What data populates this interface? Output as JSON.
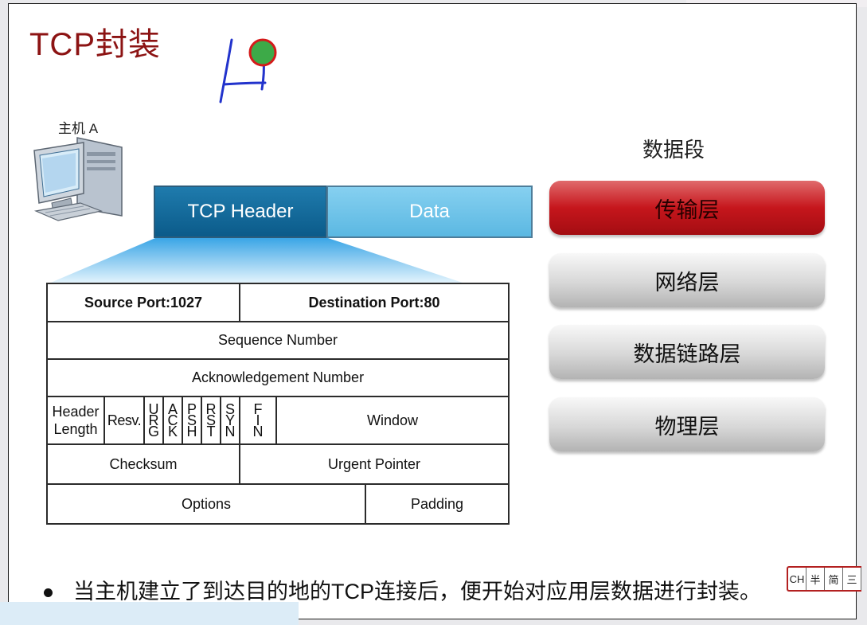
{
  "slide": {
    "title": "TCP封装",
    "host_label": "主机 A",
    "segment": {
      "header_label": "TCP Header",
      "data_label": "Data"
    },
    "tcp_header": {
      "source_port": "Source  Port:1027",
      "destination_port": "Destination  Port:80",
      "sequence_number": "Sequence Number",
      "ack_number": "Acknowledgement Number",
      "header_length": [
        "Header",
        "Length"
      ],
      "reserved": "Resv.",
      "flags": [
        [
          "U",
          "R",
          "G"
        ],
        [
          "A",
          "C",
          "K"
        ],
        [
          "P",
          "S",
          "H"
        ],
        [
          "R",
          "S",
          "T"
        ],
        [
          "S",
          "Y",
          "N"
        ],
        [
          "F",
          "I",
          "N"
        ]
      ],
      "window": "Window",
      "checksum": "Checksum",
      "urgent_pointer": "Urgent  Pointer",
      "options": "Options",
      "padding": "Padding"
    },
    "layers": {
      "caption": "数据段",
      "items": [
        {
          "label": "传输层",
          "active": true
        },
        {
          "label": "网络层",
          "active": false
        },
        {
          "label": "数据链路层",
          "active": false
        },
        {
          "label": "物理层",
          "active": false
        }
      ]
    },
    "bullet": "当主机建立了到达目的地的TCP连接后，便开始对应用层数据进行封装。"
  },
  "ime_toolbar": [
    "CH",
    "半",
    "简",
    "三"
  ],
  "colors": {
    "title": "#8c1313",
    "tcp_header_fill": "#0b5b8a",
    "data_fill": "#6cc1e8",
    "active_layer": "#c6161c",
    "port_text": "#b01622",
    "annotation_pen": "#2233cc",
    "annotation_dot": "#3daa48"
  },
  "icons": {
    "host": "desktop-computer-icon",
    "pen_annotation": "hand-drawn-annotation"
  }
}
